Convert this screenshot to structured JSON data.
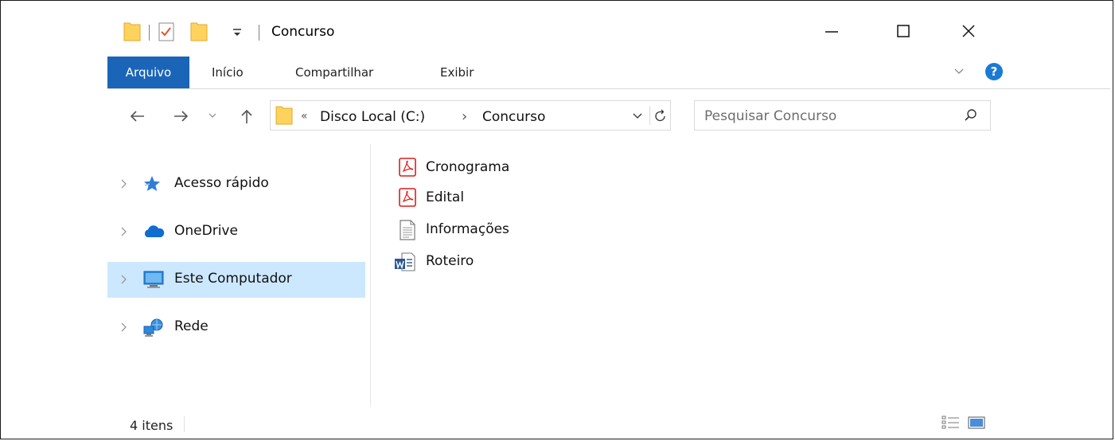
{
  "window": {
    "title": "Concurso",
    "controls": {
      "minimize": "minimize",
      "maximize": "maximize",
      "close": "close"
    }
  },
  "ribbon": {
    "tabs": [
      {
        "label": "Arquivo",
        "active": true
      },
      {
        "label": "Início"
      },
      {
        "label": "Compartilhar"
      },
      {
        "label": "Exibir"
      }
    ]
  },
  "address": {
    "overflow": "«",
    "crumbs": [
      "Disco Local (C:)",
      "Concurso"
    ],
    "separator": "›"
  },
  "search": {
    "placeholder": "Pesquisar Concurso"
  },
  "navpane": {
    "items": [
      {
        "label": "Acesso rápido",
        "icon": "star-icon"
      },
      {
        "label": "OneDrive",
        "icon": "cloud-icon"
      },
      {
        "label": "Este Computador",
        "icon": "computer-icon",
        "selected": true
      },
      {
        "label": "Rede",
        "icon": "network-icon"
      }
    ]
  },
  "files": [
    {
      "name": "Cronograma",
      "type": "pdf"
    },
    {
      "name": "Edital",
      "type": "pdf"
    },
    {
      "name": "Informações",
      "type": "text"
    },
    {
      "name": "Roteiro",
      "type": "word"
    }
  ],
  "status": {
    "count": "4 itens"
  },
  "colors": {
    "accent": "#1a65b8",
    "selected": "#cce8ff",
    "pdf": "#d81e1e",
    "folder": "#ffd25e"
  }
}
